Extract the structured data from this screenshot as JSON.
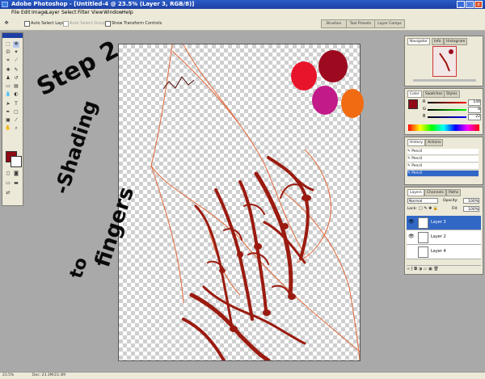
{
  "window": {
    "title": "Adobe Photoshop - [Untitled-4 @ 23.5% (Layer 3, RGB/8)]",
    "minimize": "_",
    "maximize": "□",
    "close": "x"
  },
  "menu": [
    "File",
    "Edit",
    "Image",
    "Layer",
    "Select",
    "Filter",
    "View",
    "Window",
    "Help"
  ],
  "options_bar": {
    "auto_select_layer": "Auto Select Layer",
    "auto_select_groups": "Auto Select Groups",
    "show_transform_controls": "Show Transform Controls"
  },
  "palette_well": [
    "Brushes",
    "Tool Presets",
    "Layer Comps"
  ],
  "navigator": {
    "tabs": [
      "Navigator",
      "Info",
      "Histogram"
    ]
  },
  "color_panel": {
    "tabs": [
      "Color",
      "Swatches",
      "Styles"
    ],
    "channels": [
      {
        "label": "R",
        "value": "144",
        "color": "#c00000"
      },
      {
        "label": "G",
        "value": "8",
        "color": "#00a000"
      },
      {
        "label": "B",
        "value": "22",
        "color": "#0000c0"
      }
    ],
    "foreground": "#8f0a16"
  },
  "history_panel": {
    "tabs": [
      "History",
      "Actions"
    ],
    "items": [
      "Pencil",
      "Pencil",
      "Pencil",
      "Pencil"
    ]
  },
  "layers_panel": {
    "tabs": [
      "Layers",
      "Channels",
      "Paths"
    ],
    "blend_mode": "Normal",
    "opacity_label": "Opacity:",
    "opacity_value": "100%",
    "lock_label": "Lock:",
    "fill_label": "Fill:",
    "fill_value": "100%",
    "layers": [
      {
        "name": "Layer 3",
        "selected": true
      },
      {
        "name": "Layer 2",
        "selected": false
      },
      {
        "name": "Layer 4",
        "selected": false
      }
    ]
  },
  "annotation": {
    "line1": "Step 2",
    "line2": "-Shading",
    "line3": "to",
    "line4": "fingers"
  },
  "swatches": [
    "#e8142b",
    "#9d0a1f",
    "#c21a88",
    "#f06b12"
  ],
  "status": {
    "zoom": "23.5%",
    "doc": "Doc: 23.3M/23.3M"
  }
}
